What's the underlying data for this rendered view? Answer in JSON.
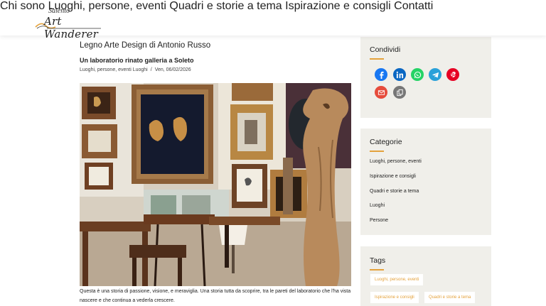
{
  "header": {
    "logo_line1": "Salento",
    "logo_line2": "Art Wanderer",
    "nav": [
      "Chi sono",
      "Luoghi, persone, eventi",
      "Quadri e storie a tema",
      "Ispirazione e consigli",
      "Contatti"
    ]
  },
  "article": {
    "title": "Legno Arte Design di Antonio Russo",
    "subtitle": "Un laboratorio rinato galleria a Soleto",
    "meta_categories": "Luoghi, persone, eventi Luoghi",
    "meta_separator": "/",
    "meta_date": "Ven, 06/02/2026",
    "caption": "Questa è una storia di passione, visione, e meraviglia. Una storia tutta da scoprire, tra le pareti del laboratorio che l'ha vista nascere e che continua a vederla crescere."
  },
  "sidebar": {
    "share_title": "Condividi",
    "share_icons": [
      {
        "name": "facebook-icon",
        "glyph": "f",
        "color": "#1877f2"
      },
      {
        "name": "linkedin-icon",
        "glyph": "in",
        "color": "#0a66c2"
      },
      {
        "name": "whatsapp-icon",
        "glyph": "w",
        "color": "#25d366"
      },
      {
        "name": "telegram-icon",
        "glyph": "t",
        "color": "#2aa1d9"
      },
      {
        "name": "pinterest-icon",
        "glyph": "p",
        "color": "#e60023"
      },
      {
        "name": "email-icon",
        "glyph": "m",
        "color": "#e64c3c"
      },
      {
        "name": "copy-link-icon",
        "glyph": "c",
        "color": "#777777"
      }
    ],
    "categories_title": "Categorie",
    "categories": [
      "Luoghi, persone, eventi",
      "Ispirazione e consigli",
      "Quadri e storie a tema",
      "Luoghi",
      "Persone"
    ],
    "tags_title": "Tags",
    "tags": [
      "Luoghi, persone, eventi",
      "Ispirazione e consigli",
      "Quadri e storie a tema"
    ]
  },
  "colors": {
    "accent": "#e4a23c",
    "widget_bg": "#f0efea"
  }
}
